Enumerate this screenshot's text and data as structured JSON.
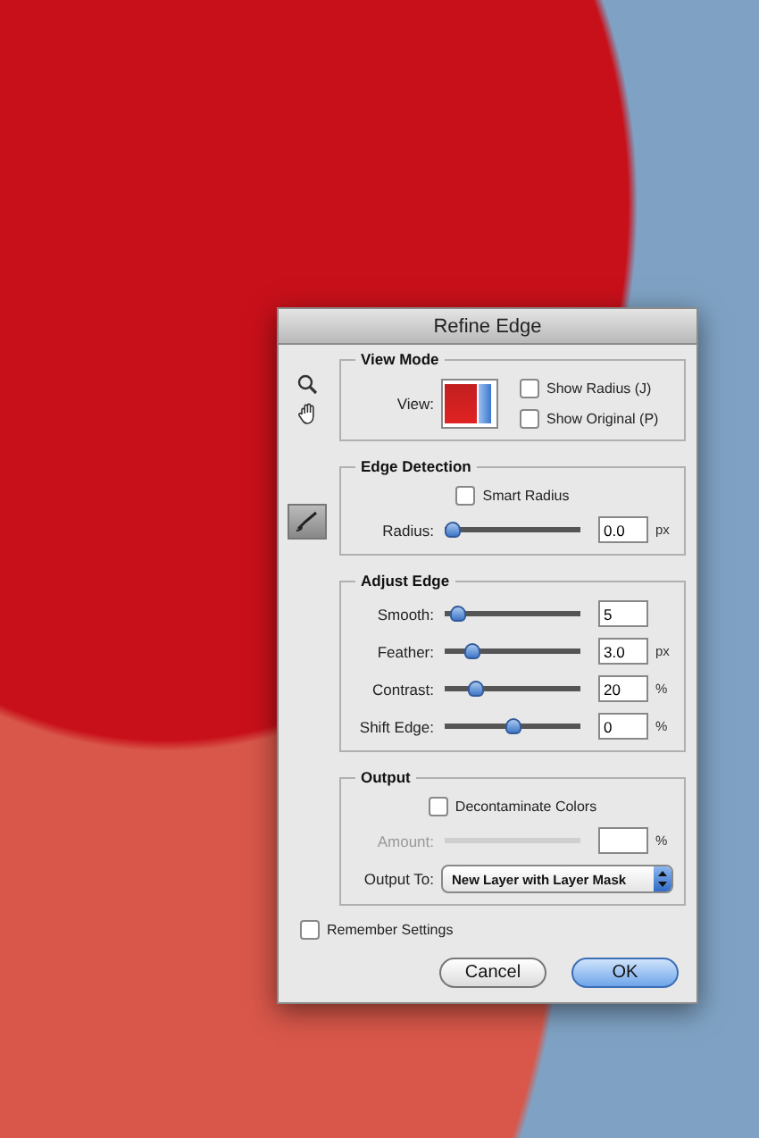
{
  "window": {
    "title": "Refine Edge"
  },
  "view_mode": {
    "title": "View Mode",
    "view_label": "View:",
    "checkboxes": [
      {
        "label": "Show Radius (J)",
        "checked": false
      },
      {
        "label": "Show Original (P)",
        "checked": false
      }
    ]
  },
  "edge_detection": {
    "title": "Edge Detection",
    "smart_radius": {
      "label": "Smart Radius",
      "checked": false
    },
    "sliders": [
      {
        "label": "Radius:",
        "level": 0,
        "value": "0.0",
        "unit": "px",
        "disabled": false
      }
    ]
  },
  "adjust_edge": {
    "title": "Adjust Edge",
    "sliders": [
      {
        "label": "Smooth:",
        "level": 0.05,
        "value": "5",
        "disabled": false
      },
      {
        "label": "Feather:",
        "level": 0.17,
        "value": "3.0",
        "unit": "px",
        "disabled": false
      },
      {
        "label": "Contrast:",
        "level": 0.2,
        "value": "20",
        "unit": "%",
        "disabled": false
      },
      {
        "label": "Shift Edge:",
        "level": 0.5,
        "value": "0",
        "unit": "%",
        "disabled": false
      }
    ]
  },
  "output": {
    "title": "Output",
    "decontaminate": {
      "label": "Decontaminate Colors",
      "checked": false
    },
    "sliders": [
      {
        "label": "Amount:",
        "unit": "%",
        "disabled": true
      }
    ],
    "output_to": {
      "label": "Output To:",
      "value": "New Layer with Layer Mask"
    }
  },
  "remember": {
    "label": "Remember Settings",
    "checked": false
  },
  "buttons": [
    {
      "label": "Cancel",
      "default": false
    },
    {
      "label": "OK",
      "default": true
    }
  ]
}
